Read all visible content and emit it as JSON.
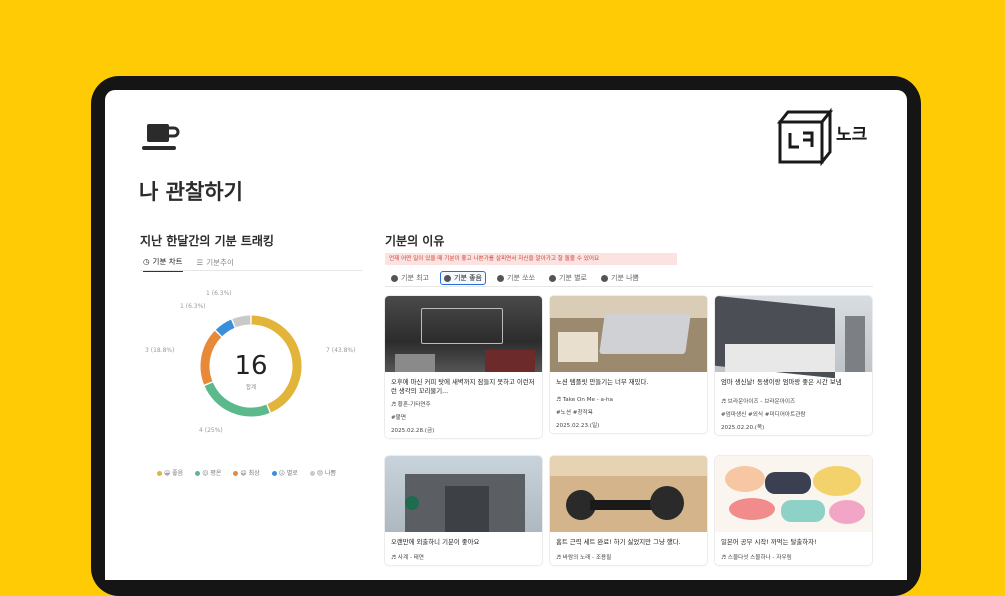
{
  "page": {
    "title": "나 관찰하기"
  },
  "left": {
    "heading": "지난 한달간의 기분 트래킹",
    "tabs": [
      {
        "label": "기분 차트"
      },
      {
        "label": "기분추이"
      }
    ],
    "chart_data": {
      "type": "pie",
      "center_value": "16",
      "center_label": "합계",
      "slices": [
        {
          "name": "좋음",
          "value": 7,
          "label": "7 (43.8%)",
          "color": "#E2B43A"
        },
        {
          "name": "평온",
          "value": 4,
          "label": "4 (25%)",
          "color": "#5BB98C"
        },
        {
          "name": "최상",
          "value": 3,
          "label": "3 (18.8%)",
          "color": "#E8893A"
        },
        {
          "name": "별로",
          "value": 1,
          "label": "1 (6.3%)",
          "color": "#3A8FD8"
        },
        {
          "name": "나쁨",
          "value": 1,
          "label": "1 (6.3%)",
          "color": "#C9C9C9"
        }
      ]
    },
    "legend": [
      {
        "label": "😀 좋음",
        "color": "#E2B43A"
      },
      {
        "label": "😌 평온",
        "color": "#5BB98C"
      },
      {
        "label": "😄 최상",
        "color": "#E8893A"
      },
      {
        "label": "😕 별로",
        "color": "#3A8FD8"
      },
      {
        "label": "😞 나쁨",
        "color": "#C9C9C9"
      }
    ]
  },
  "right": {
    "heading": "기분의 이유",
    "reason_text": "언제 어떤 일이 있을 때 기분이 좋고 나쁜가를 살피면서 자신을   알아가고 잘 돌볼 수 있어요",
    "tabs": [
      {
        "label": "기분 최고"
      },
      {
        "label": "기분 좋음"
      },
      {
        "label": "기분 쏘쏘"
      },
      {
        "label": "기분 별로"
      },
      {
        "label": "기분 나쁨"
      }
    ],
    "cards": [
      {
        "title": "오후에 마신 커피 탓에 새벽까지 잠들지 못하고 이런저런 생각의 꼬리물기...",
        "music": "♬ 황혼-기타연주",
        "tag": "#불면",
        "date": "2025.02.28.(금)"
      },
      {
        "title": "노션 템플릿 만들기는 너무 재밌다.",
        "music": "♬ Take On Me - a-ha",
        "tag": "#노션 #창작욕",
        "date": "2025.02.23.(일)"
      },
      {
        "title": "엄마 생신날! 동생이랑 엄마랑 좋은 시간 보냄",
        "music": "♬ 브라운아이즈 - 브라운아이즈",
        "tag": "#엄마생신 #외식 #미디어아트관람",
        "date": "2025.02.20.(목)"
      },
      {
        "title": "오랜만에 외출하니 기분이 좋아요",
        "music": "♬ 사계 - 태연"
      },
      {
        "title": "홈트 근력 세트 완료! 하기 싫었지만 그냥 했다.",
        "music": "♬ 바람의 노래 - 조용필"
      },
      {
        "title": "일본어 공부 시작!  까먹는 탈출하자!",
        "music": "♬ 스물다섯 스물하나 - 자우림"
      }
    ]
  },
  "logo": {
    "text": "노크"
  }
}
